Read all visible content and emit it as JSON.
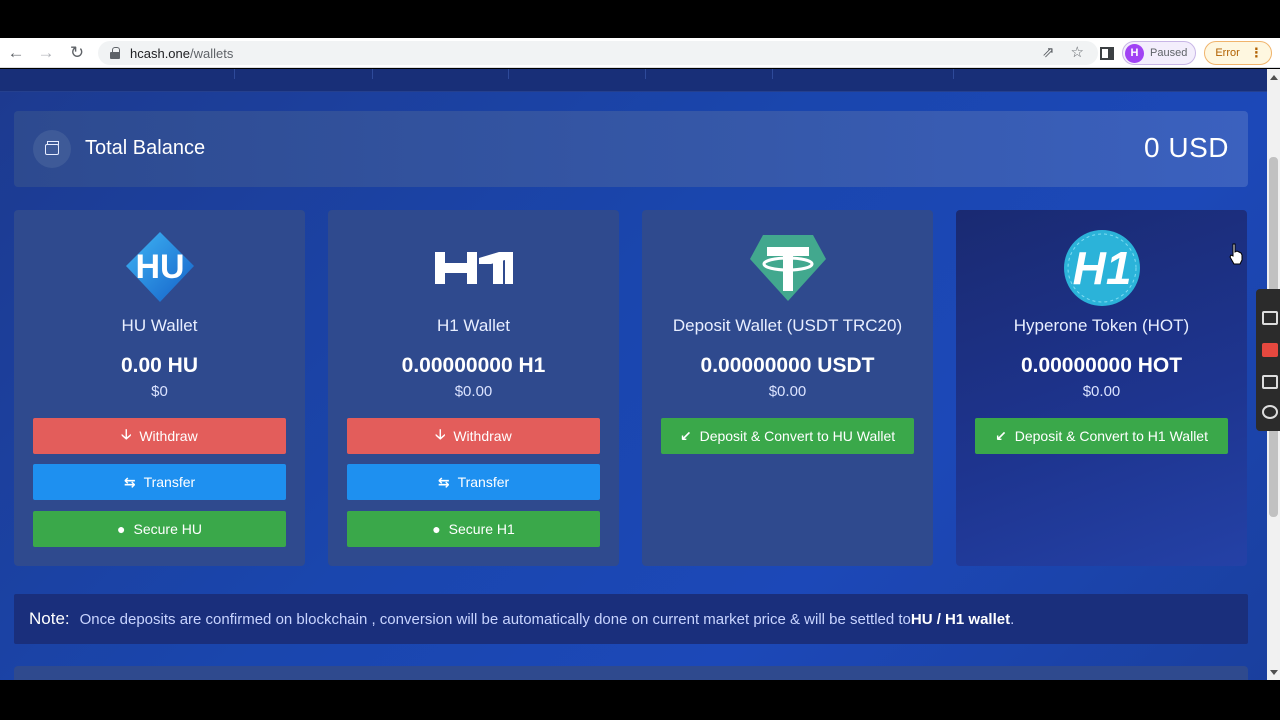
{
  "browser": {
    "url_domain": "hcash.one",
    "url_path": "/wallets",
    "profile_initial": "H",
    "profile_status": "Paused",
    "error_label": "Error"
  },
  "balance": {
    "title": "Total Balance",
    "amount": "0 USD"
  },
  "wallets": [
    {
      "icon": "hu-logo-icon",
      "title": "HU Wallet",
      "amount": "0.00 HU",
      "usd": "$0",
      "buttons": [
        {
          "label": "Withdraw",
          "icon": "arrow-down-icon",
          "color": "#e35d5b"
        },
        {
          "label": "Transfer",
          "icon": "transfer-arrows-icon",
          "color": "#1e90f0"
        },
        {
          "label": "Secure HU",
          "icon": "user-icon",
          "color": "#3aa84a"
        }
      ]
    },
    {
      "icon": "h1-logo-icon",
      "title": "H1 Wallet",
      "amount": "0.00000000 H1",
      "usd": "$0.00",
      "buttons": [
        {
          "label": "Withdraw",
          "icon": "arrow-down-icon",
          "color": "#e35d5b"
        },
        {
          "label": "Transfer",
          "icon": "transfer-arrows-icon",
          "color": "#1e90f0"
        },
        {
          "label": "Secure H1",
          "icon": "user-icon",
          "color": "#3aa84a"
        }
      ]
    },
    {
      "icon": "tether-logo-icon",
      "title": "Deposit Wallet (USDT TRC20)",
      "amount": "0.00000000 USDT",
      "usd": "$0.00",
      "buttons": [
        {
          "label": "Deposit & Convert to HU Wallet",
          "icon": "arrow-down-left-icon",
          "color": "#3aa84a"
        }
      ]
    },
    {
      "icon": "hyperone-logo-icon",
      "title": "Hyperone Token (HOT)",
      "amount": "0.00000000 HOT",
      "usd": "$0.00",
      "buttons": [
        {
          "label": "Deposit & Convert to H1 Wallet",
          "icon": "arrow-down-left-icon",
          "color": "#3aa84a"
        }
      ]
    }
  ],
  "note": {
    "label": "Note:",
    "text": "Once deposits are confirmed on blockchain , conversion will be automatically done on current market price & will be settled to ",
    "bold": "HU / H1 wallet",
    "end": "."
  }
}
